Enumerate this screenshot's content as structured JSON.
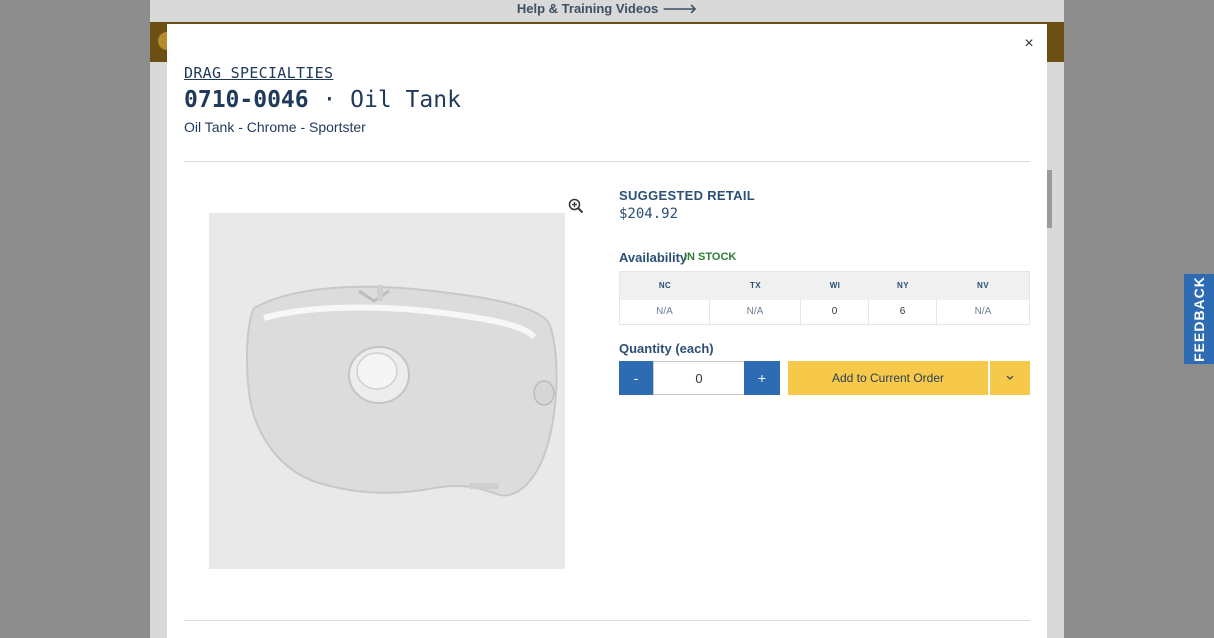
{
  "background": {
    "help_link": "Help & Training Videos",
    "help_arrow": "🡒"
  },
  "modal": {
    "close_label": "×",
    "brand": "DRAG SPECIALTIES",
    "part_number": "0710-0046",
    "separator": " · ",
    "product_name": "Oil Tank",
    "description": "Oil Tank - Chrome - Sportster",
    "zoom_icon": "magnifier-plus-icon",
    "pricing": {
      "label": "SUGGESTED RETAIL",
      "price": "$204.92"
    },
    "availability": {
      "label": "Availability",
      "status": "IN STOCK",
      "warehouses": [
        {
          "code": "NC",
          "value": "N/A"
        },
        {
          "code": "TX",
          "value": "N/A"
        },
        {
          "code": "WI",
          "value": "0"
        },
        {
          "code": "NY",
          "value": "6"
        },
        {
          "code": "NV",
          "value": "N/A"
        }
      ]
    },
    "quantity": {
      "label": "Quantity (each)",
      "minus": "-",
      "value": "0",
      "plus": "+"
    },
    "add_to_order": "Add to Current Order",
    "dropdown_icon": "chevron-down-icon"
  },
  "feedback_label": "FEEDBACK",
  "colors": {
    "primary_blue": "#2d6bb3",
    "accent_yellow": "#f6c94a",
    "heading_navy": "#1f3a5a",
    "in_stock_green": "#2e7d32"
  }
}
